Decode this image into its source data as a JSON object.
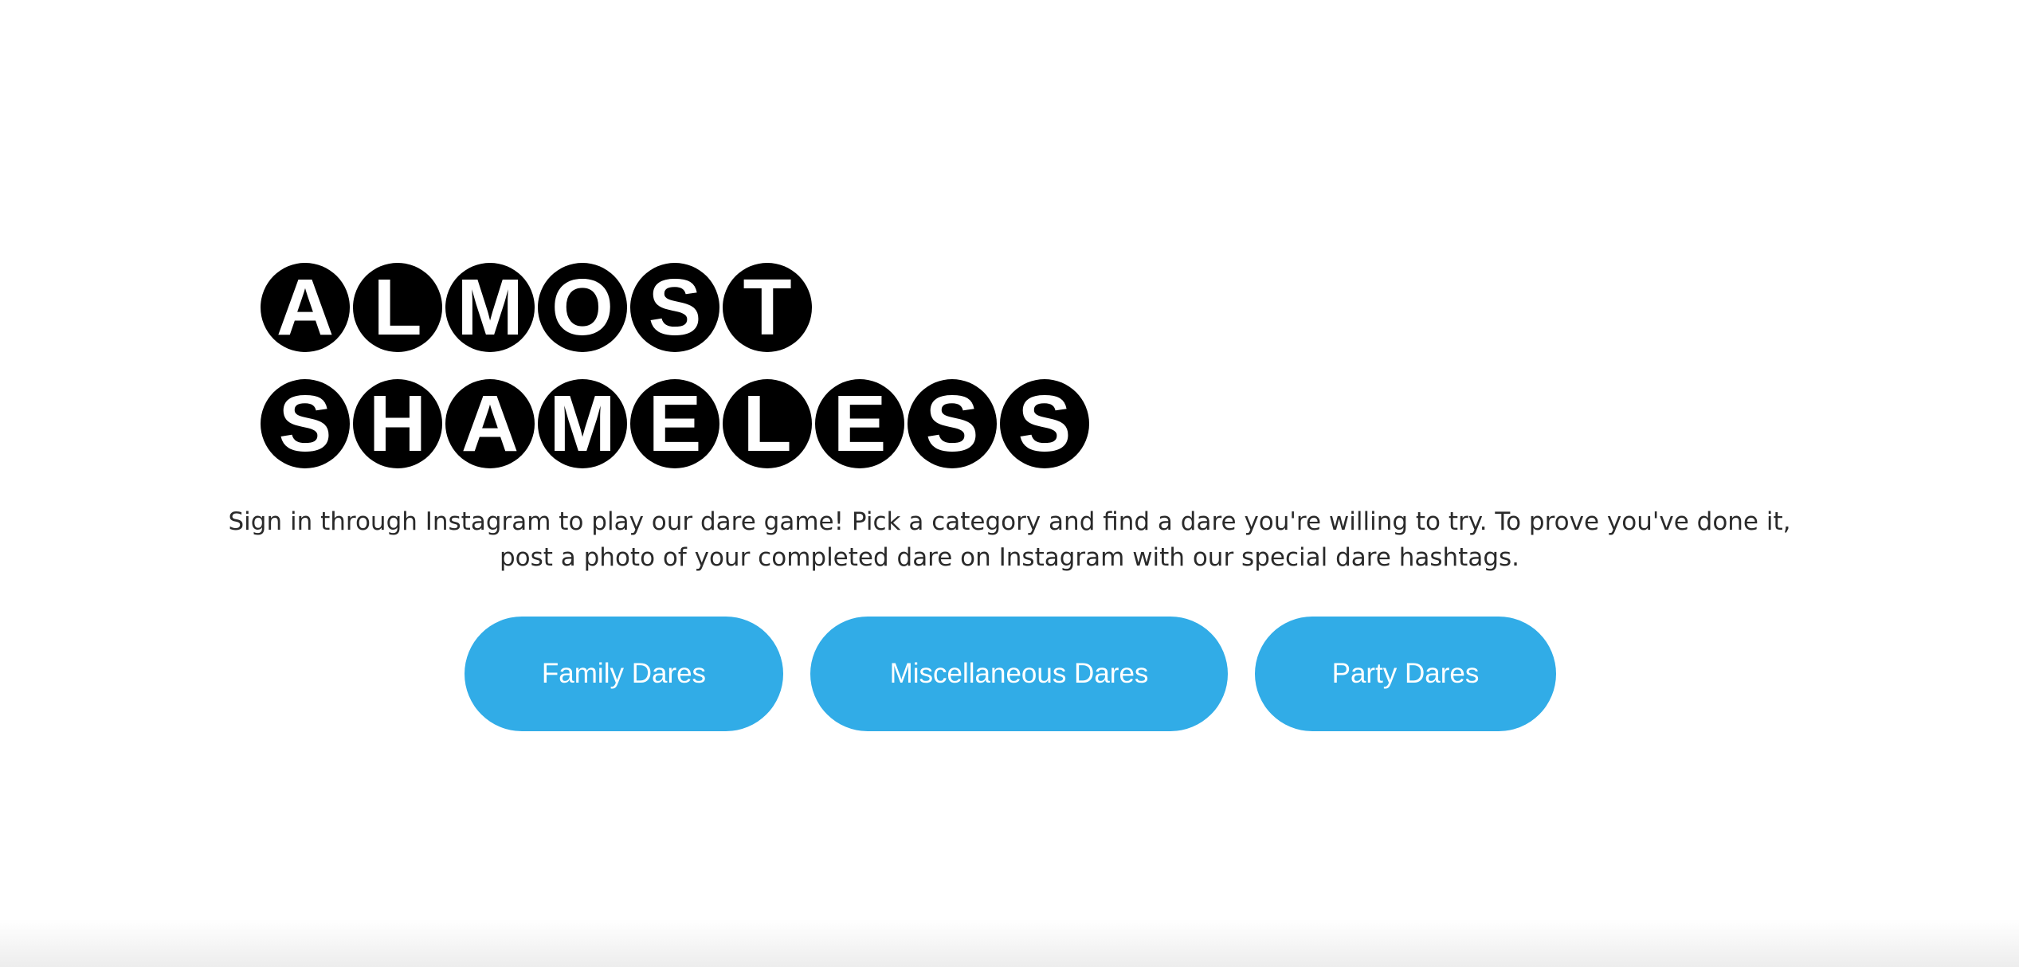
{
  "logo": {
    "line1": [
      "A",
      "L",
      "M",
      "O",
      "S",
      "T"
    ],
    "line2": [
      "S",
      "H",
      "A",
      "M",
      "E",
      "L",
      "E",
      "S",
      "S"
    ]
  },
  "intro": {
    "line1": "Sign in through Instagram to play our dare game! Pick a category and find a dare you're willing to try. To prove you've done it,",
    "line2": "post a photo of your completed dare on Instagram with our special dare hashtags."
  },
  "categories": {
    "family": "Family Dares",
    "misc": "Miscellaneous Dares",
    "party": "Party Dares"
  },
  "colors": {
    "accent": "#31ace7",
    "logo_circle": "#000000"
  }
}
